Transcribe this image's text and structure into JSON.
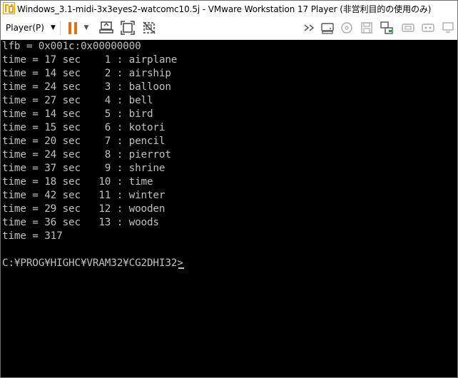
{
  "window": {
    "title": "Windows_3.1-midi-3x3eyes2-watcomc10.5j - VMware Workstation 17 Player (非営利目的の使用のみ)",
    "controls": {
      "minimize": "–",
      "maximize": "☐",
      "close": "✕"
    }
  },
  "toolbar": {
    "player_menu_label": "Player(P)",
    "player_menu_caret": "▼",
    "pause_caret": "▼",
    "icons": [
      "pause-icon",
      "send-ctrl-alt-del-icon",
      "fullscreen-icon",
      "unity-icon",
      "forward-icon",
      "hard-disk-icon",
      "cd-dvd-icon",
      "floppy-icon",
      "network-icon",
      "usb-icon",
      "sound-icon"
    ],
    "accent_color": "#e8710a"
  },
  "console": {
    "lines": [
      "lfb = 0x001c:0x00000000",
      "time = 17 sec    1 : airplane",
      "time = 14 sec    2 : airship",
      "time = 24 sec    3 : balloon",
      "time = 27 sec    4 : bell",
      "time = 14 sec    5 : bird",
      "time = 15 sec    6 : kotori",
      "time = 20 sec    7 : pencil",
      "time = 24 sec    8 : pierrot",
      "time = 37 sec    9 : shrine",
      "time = 18 sec   10 : time",
      "time = 42 sec   11 : winter",
      "time = 29 sec   12 : wooden",
      "time = 36 sec   13 : woods",
      "time = 317",
      "",
      "C:¥PROG¥HIGHC¥VRAM32¥CG2DHI32> "
    ],
    "text_color": "#c0c0c0",
    "background": "#000000"
  }
}
